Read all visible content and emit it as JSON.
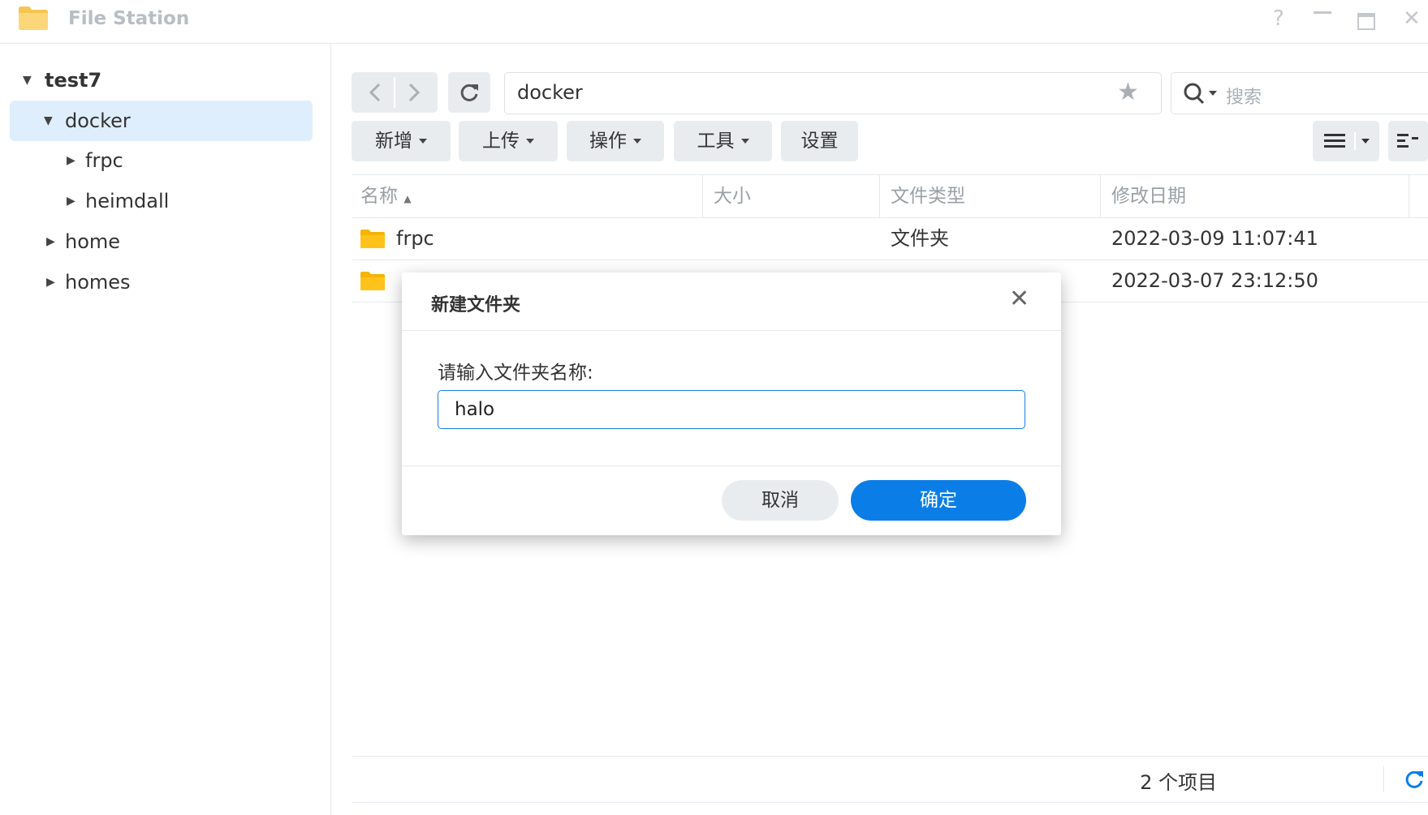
{
  "window": {
    "title": "File Station",
    "controls": [
      "help-icon",
      "minimize-icon",
      "maximize-icon",
      "close-icon"
    ]
  },
  "sidebar": {
    "root": "test7",
    "items": [
      {
        "label": "docker",
        "expanded": true,
        "selected": true
      },
      {
        "label": "frpc",
        "expanded": false
      },
      {
        "label": "heimdall",
        "expanded": false
      },
      {
        "label": "home",
        "expanded": false
      },
      {
        "label": "homes",
        "expanded": false
      }
    ]
  },
  "toolbar": {
    "path": "docker",
    "search_placeholder": "搜索",
    "menus": [
      "新增",
      "上传",
      "操作",
      "工具",
      "设置"
    ]
  },
  "table": {
    "columns": {
      "name": "名称",
      "size": "大小",
      "type": "文件类型",
      "modified": "修改日期"
    },
    "rows": [
      {
        "name": "frpc",
        "size": "",
        "type": "文件夹",
        "modified": "2022-03-09 11:07:41"
      },
      {
        "name": "",
        "size": "",
        "type": "",
        "modified": "2022-03-07 23:12:50"
      }
    ]
  },
  "footer": {
    "item_count": "2 个项目"
  },
  "dialog": {
    "title": "新建文件夹",
    "prompt": "请输入文件夹名称:",
    "input_value": "halo",
    "cancel_label": "取消",
    "ok_label": "确定"
  },
  "colors": {
    "accent": "#0a7ee6",
    "selection": "#dfeefc",
    "folder": "#f5b400"
  }
}
